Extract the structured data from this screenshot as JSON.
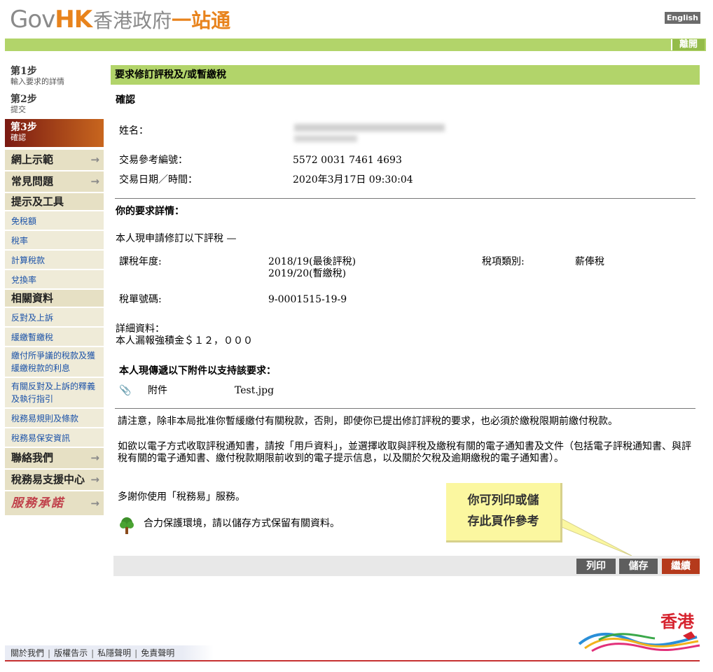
{
  "header": {
    "logo_gov": "Gov",
    "logo_hk": "HK",
    "logo_cn1": "香港政府",
    "logo_cn2": "一站通",
    "english": "English",
    "exit": "離開"
  },
  "sidebar": {
    "steps": [
      {
        "title": "第1步",
        "sub": "輸入要求的詳情"
      },
      {
        "title": "第2步",
        "sub": "提交"
      },
      {
        "title": "第3步",
        "sub": "確認"
      }
    ],
    "demo": "網上示範",
    "faq": "常見問題",
    "tips": "提示及工具",
    "tips_items": [
      "免稅額",
      "稅率",
      "計算稅款",
      "兌換率"
    ],
    "related": "相關資料",
    "related_items": [
      "反對及上訴",
      "緩繳暫繳稅",
      "繳付所爭議的稅款及獲緩繳稅款的利息",
      "有關反對及上訴的釋義及執行指引",
      "稅務易規則及條款",
      "稅務易保安資訊"
    ],
    "contact": "聯絡我們",
    "support": "稅務易支援中心",
    "pledge": "服務承諾"
  },
  "main": {
    "title": "要求修訂評稅及/或暫繳稅",
    "confirm": "確認",
    "name_label": "姓名：",
    "ref_label": "交易參考編號：",
    "ref_value": "5572 0031 7461 4693",
    "date_label": "交易日期／時間：",
    "date_value": "2020年3月17日 09:30:04",
    "details_head": "你的要求詳情：",
    "apply_text": "本人現申請修訂以下評稅 —",
    "year_label": "課稅年度:",
    "year_value1": "2018/19(最後評稅)",
    "year_value2": "2019/20(暫繳稅)",
    "taxtype_label": "稅項類別:",
    "taxtype_value": "薪俸稅",
    "bill_label": "稅單號碼:",
    "bill_value": "9-0001515-19-9",
    "detail_label": "詳細資料：",
    "detail_value": "本人漏報強積金＄１２，０００",
    "attach_head": "本人現傳遞以下附件以支持該要求：",
    "attach_label": "附件",
    "attach_file": "Test.jpg",
    "notice": "請注意，除非本局批准你暫緩繳付有關稅款，否則，即使你已提出修訂評稅的要求，也必須於繳稅限期前繳付稅款。",
    "electronic": "如欲以電子方式收取評稅通知書，請按「用戶資料」，並選擇收取與評稅及繳稅有關的電子通知書及文件（包括電子評稅通知書、與評稅有關的電子通知書、繳付稅款期限前收到的電子提示信息，以及關於欠稅及逾期繳稅的電子通知書）。",
    "thanks": "多謝你使用「稅務易」服務。",
    "green": "合力保護環境，請以儲存方式保留有關資料。"
  },
  "callout": {
    "line1": "你可列印或儲",
    "line2": "存此頁作參考"
  },
  "buttons": {
    "print": "列印",
    "save": "儲存",
    "continue": "繼續"
  },
  "footer": {
    "about": "關於我們",
    "copyright": "版權告示",
    "privacy": "私隱聲明",
    "disclaimer": "免責聲明",
    "hk": "香港"
  },
  "colors": {
    "green_bar": "#b2d46a",
    "active_step": "#7a1a12",
    "continue": "#b53a1c",
    "link": "#1b52a8"
  }
}
